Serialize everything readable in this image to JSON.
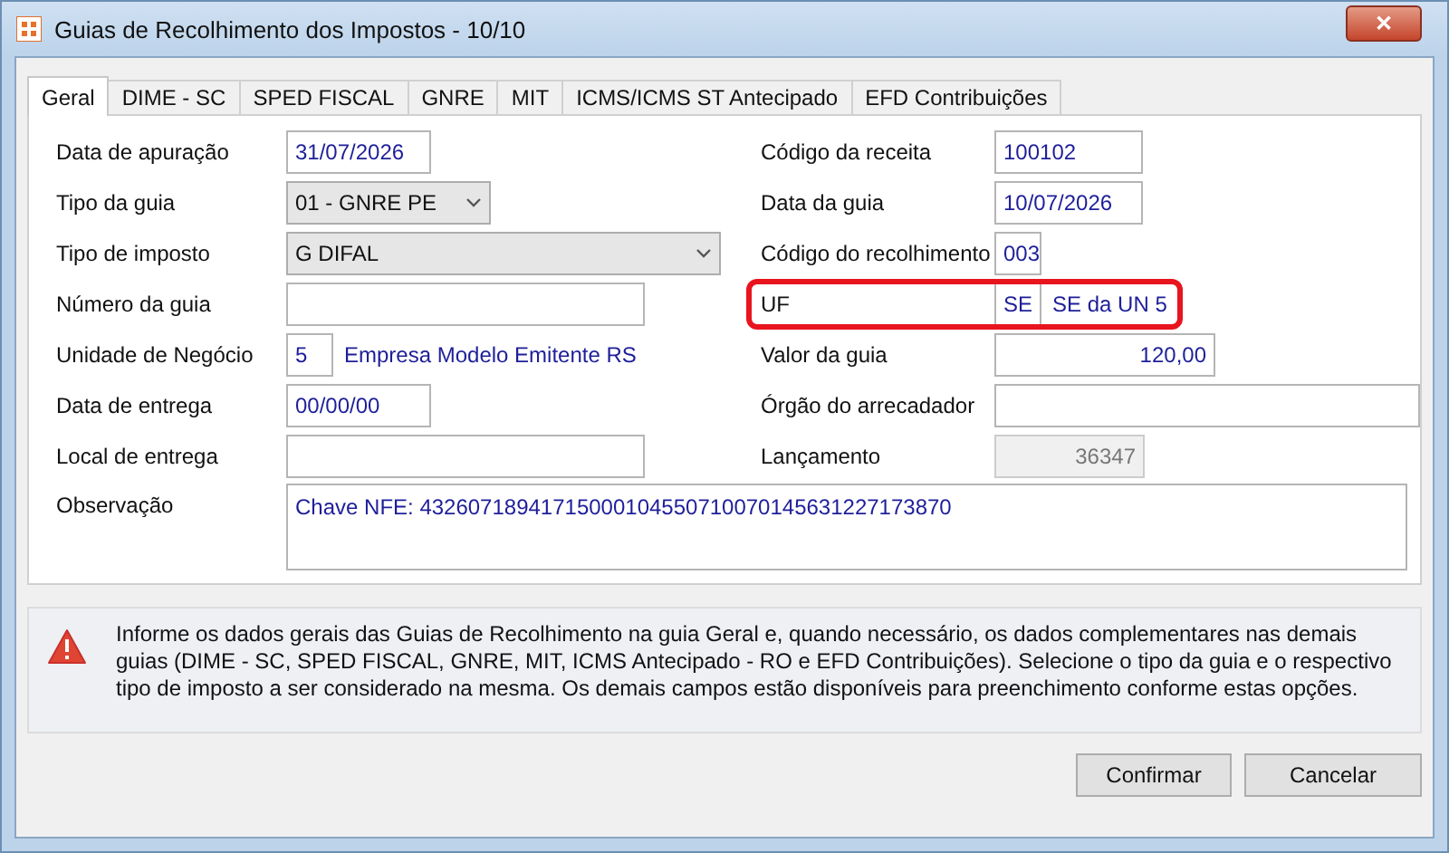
{
  "window": {
    "title": "Guias de Recolhimento dos Impostos - 10/10",
    "close": "✕"
  },
  "tabs": [
    {
      "label": "Geral",
      "selected": true
    },
    {
      "label": "DIME - SC",
      "selected": false
    },
    {
      "label": "SPED FISCAL",
      "selected": false
    },
    {
      "label": "GNRE",
      "selected": false
    },
    {
      "label": "MIT",
      "selected": false
    },
    {
      "label": "ICMS/ICMS ST Antecipado",
      "selected": false
    },
    {
      "label": "EFD Contribuições",
      "selected": false
    }
  ],
  "left_fields": [
    {
      "label": "Data de apuração",
      "kind": "text",
      "value": "31/07/2026"
    },
    {
      "label": "Tipo da guia",
      "kind": "select",
      "value": "01 - GNRE PE"
    },
    {
      "label": "Tipo de imposto",
      "kind": "select",
      "value": "G DIFAL"
    },
    {
      "label": "Número da guia",
      "kind": "text"
    },
    {
      "label": "Unidade de Negócio",
      "kind": "text",
      "value": "5",
      "description": "Empresa Modelo Emitente RS"
    },
    {
      "label": "Data de entrega",
      "kind": "text",
      "value": "00/00/00"
    },
    {
      "label": "Local de entrega",
      "kind": "text"
    }
  ],
  "right_fields": [
    {
      "label": "Código da receita",
      "kind": "text",
      "value": "100102"
    },
    {
      "label": "Data da guia",
      "kind": "text",
      "value": "10/07/2026"
    },
    {
      "label": "Código do recolhimento",
      "kind": "text",
      "value": "003"
    },
    {
      "label": "UF",
      "kind": "text",
      "value": "SE",
      "description": "SE da UN 5",
      "highlighted": true
    },
    {
      "label": "Valor da guia",
      "kind": "number",
      "value": "120,00"
    },
    {
      "label": "Órgão do arrecadador",
      "kind": "text"
    },
    {
      "label": "Lançamento",
      "kind": "number",
      "value": "36347",
      "disabled": true
    }
  ],
  "observation": {
    "label": "Observação",
    "value": "Chave NFE: 43260718941715000104550710070145631227173870"
  },
  "info": "Informe os dados gerais das Guias de Recolhimento na guia Geral e, quando necessário, os dados complementares nas demais guias (DIME - SC, SPED FISCAL, GNRE, MIT, ICMS Antecipado - RO e EFD Contribuições). Selecione o tipo da guia e o respectivo tipo de imposto a ser considerado na mesma. Os demais campos estão disponíveis para preenchimento conforme estas opções.",
  "buttons": [
    "Confirmar",
    "Cancelar"
  ]
}
